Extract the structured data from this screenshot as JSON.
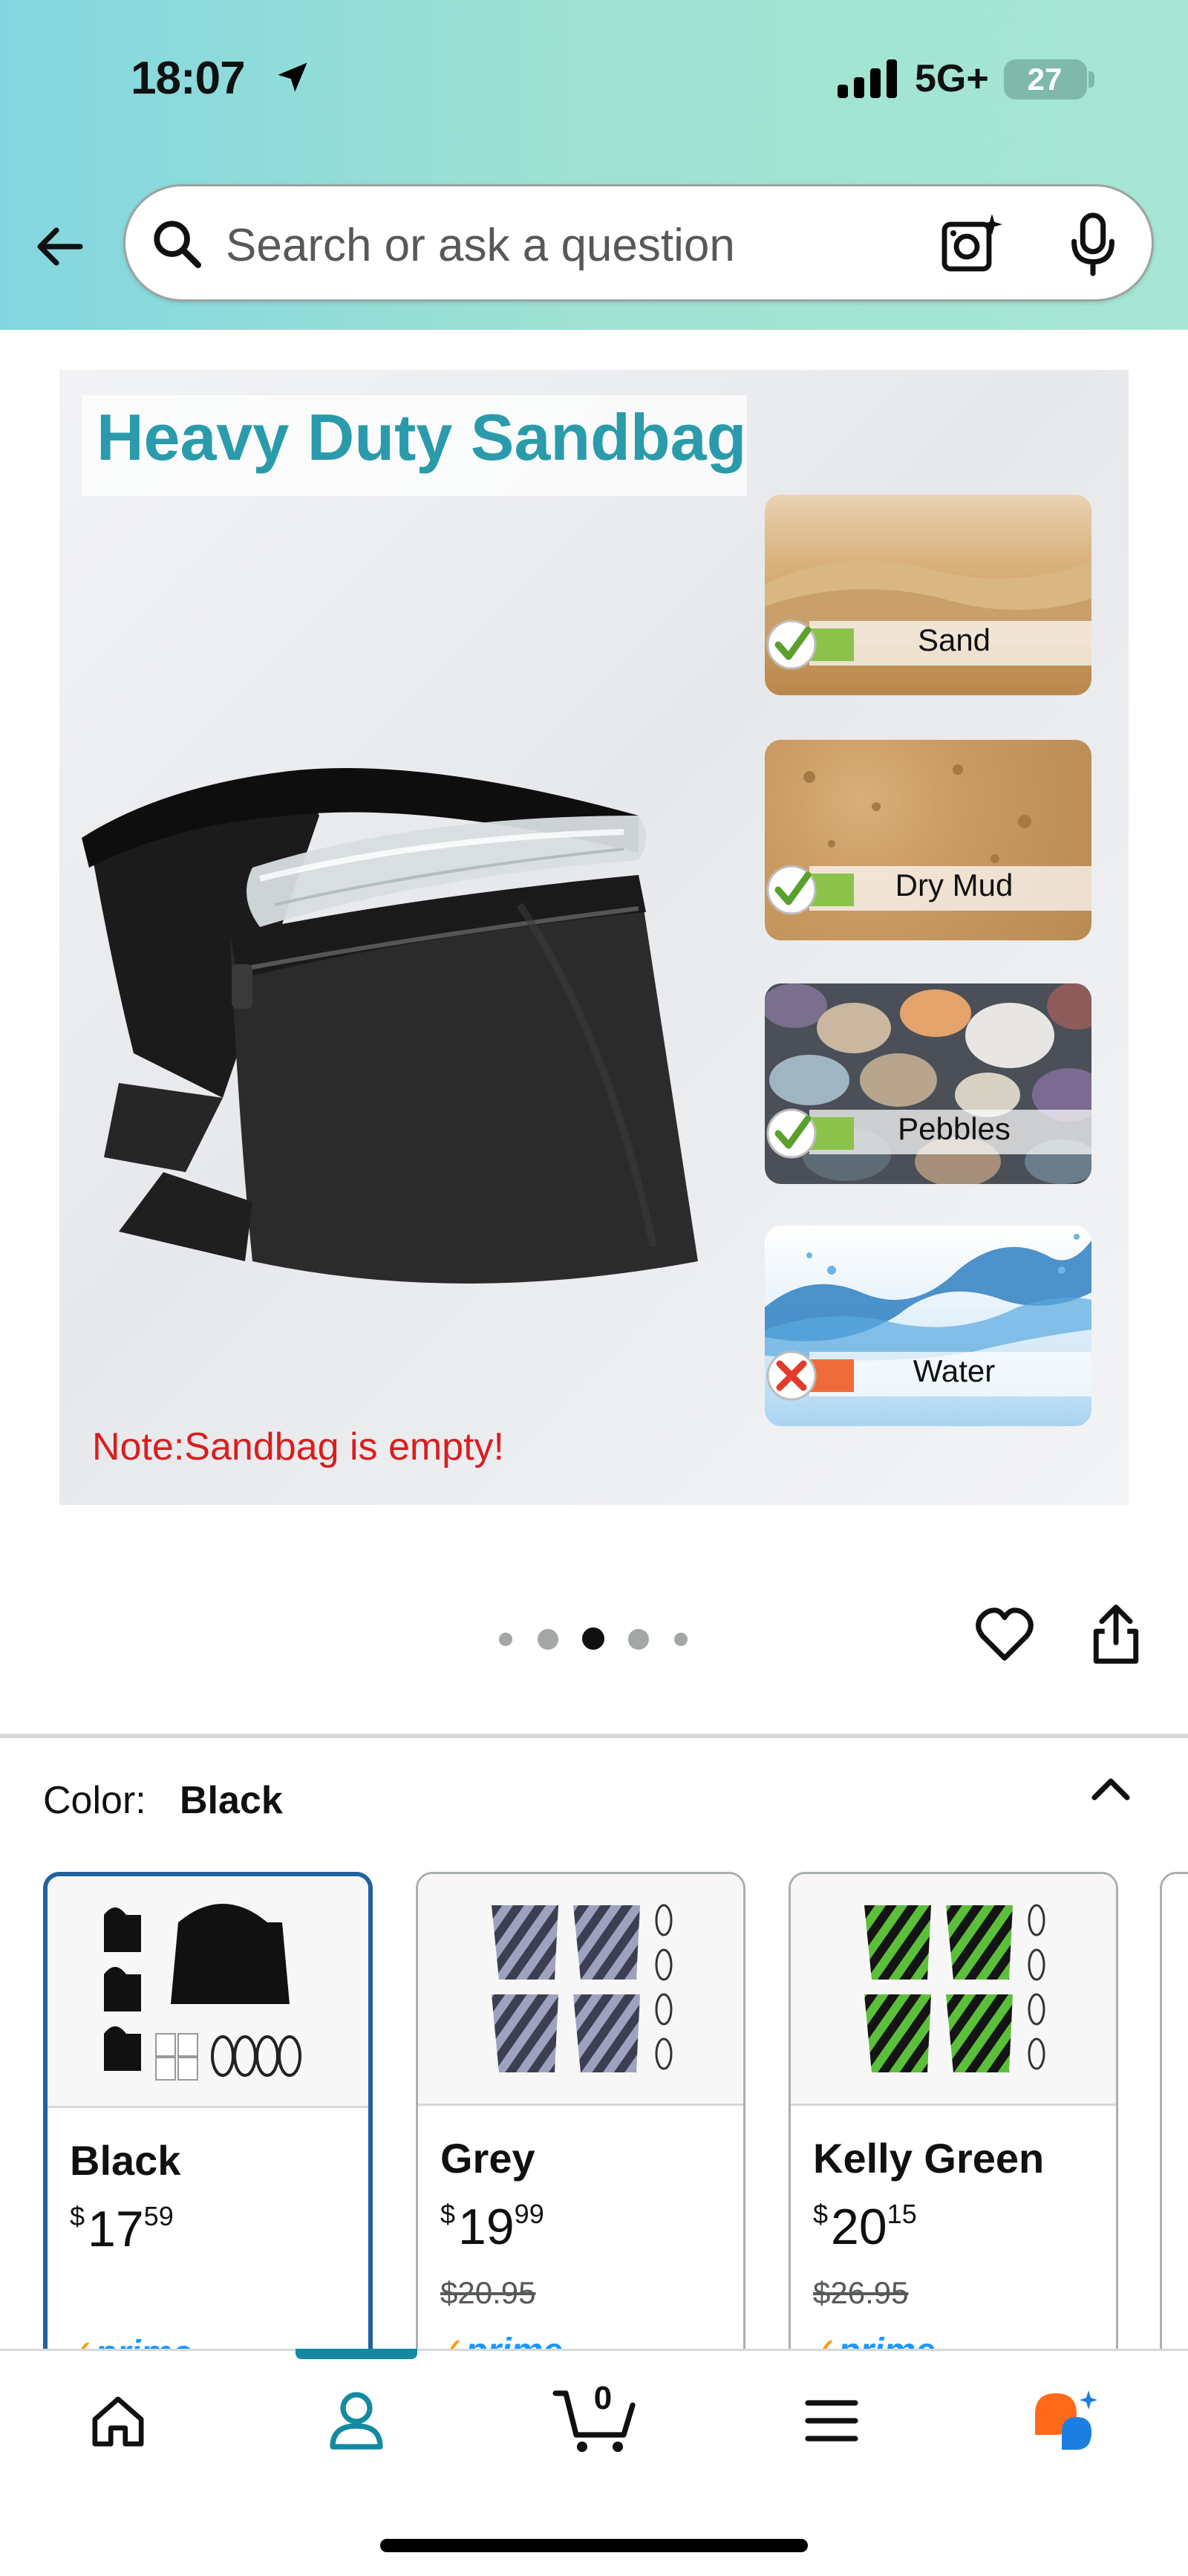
{
  "status_bar": {
    "time": "18:07",
    "network": "5G+",
    "battery": "27"
  },
  "search": {
    "placeholder": "Search or ask a question"
  },
  "product_image": {
    "title": "Heavy Duty Sandbag",
    "note": "Note:Sandbag is empty!",
    "fills": [
      {
        "label": "Sand",
        "allowed": true
      },
      {
        "label": "Dry Mud",
        "allowed": true
      },
      {
        "label": "Pebbles",
        "allowed": true
      },
      {
        "label": "Water",
        "allowed": false
      }
    ]
  },
  "carousel": {
    "count": 5,
    "active_index": 2
  },
  "variation": {
    "label": "Color:",
    "selected": "Black"
  },
  "swatches": [
    {
      "name": "Black",
      "currency": "$",
      "dollars": "17",
      "cents": "59",
      "was": "",
      "prime": "prime"
    },
    {
      "name": "Grey",
      "currency": "$",
      "dollars": "19",
      "cents": "99",
      "was": "$20.95",
      "prime": "prime"
    },
    {
      "name": "Kelly Green",
      "currency": "$",
      "dollars": "20",
      "cents": "15",
      "was": "$26.95",
      "prime": "prime"
    }
  ],
  "bottom_nav": {
    "cart_count": "0",
    "active": "account"
  },
  "colors": {
    "accent": "#138aa0",
    "selected_border": "#2162a1",
    "prime_blue": "#1a98ff",
    "prime_check": "#ff9900",
    "note_red": "#d81e1e",
    "title_teal": "#2a9bab"
  }
}
